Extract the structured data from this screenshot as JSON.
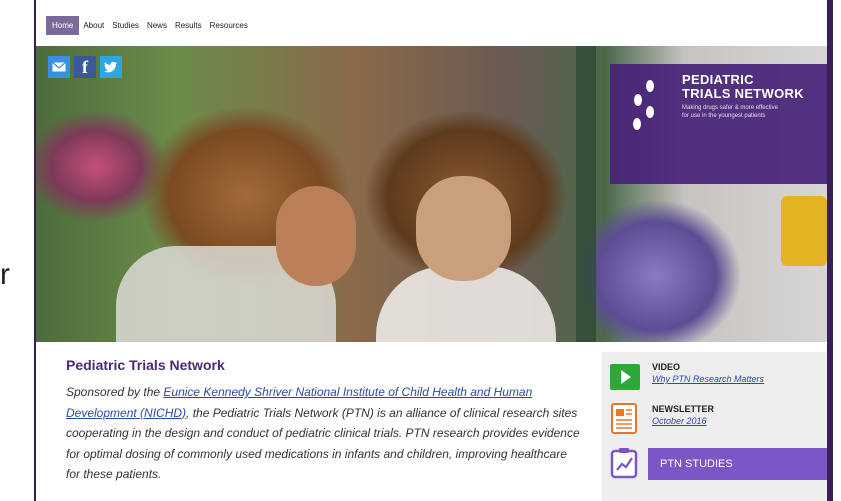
{
  "nav": {
    "items": [
      {
        "label": "Home",
        "active": true
      },
      {
        "label": "About",
        "active": false
      },
      {
        "label": "Studies",
        "active": false
      },
      {
        "label": "News",
        "active": false
      },
      {
        "label": "Results",
        "active": false
      },
      {
        "label": "Resources",
        "active": false
      }
    ]
  },
  "social": {
    "icons": [
      "mail-icon",
      "facebook-icon",
      "twitter-icon"
    ],
    "fb_glyph": "f",
    "tw_glyph": "t"
  },
  "logo": {
    "line1": "PEDIATRIC",
    "line2": "TRIALS NETWORK",
    "tagline1": "Making drugs safer & more effective",
    "tagline2": "for use in the youngest patients"
  },
  "side": {
    "stray_char": "r"
  },
  "content": {
    "title": "Pediatric Trials Network",
    "intro": "Sponsored by the ",
    "link": "Eunice Kennedy Shriver National Institute of Child Health and Human Development (NICHD)",
    "body": ", the Pediatric Trials Network (PTN) is an alliance of clinical research sites cooperating in the design and conduct of pediatric clinical trials. PTN research provides evidence for optimal dosing of commonly used medications in infants and children, improving healthcare for these patients."
  },
  "rail": {
    "video": {
      "label": "VIDEO",
      "link": "Why PTN Research Matters"
    },
    "newsletter": {
      "label": "NEWSLETTER",
      "link": "October 2016"
    },
    "studies": {
      "label": "PTN STUDIES"
    }
  },
  "colors": {
    "brand_purple": "#4a2a72",
    "studies_purple": "#7b56c6",
    "video_green": "#2fa83a",
    "newsletter_orange": "#e9772a"
  }
}
